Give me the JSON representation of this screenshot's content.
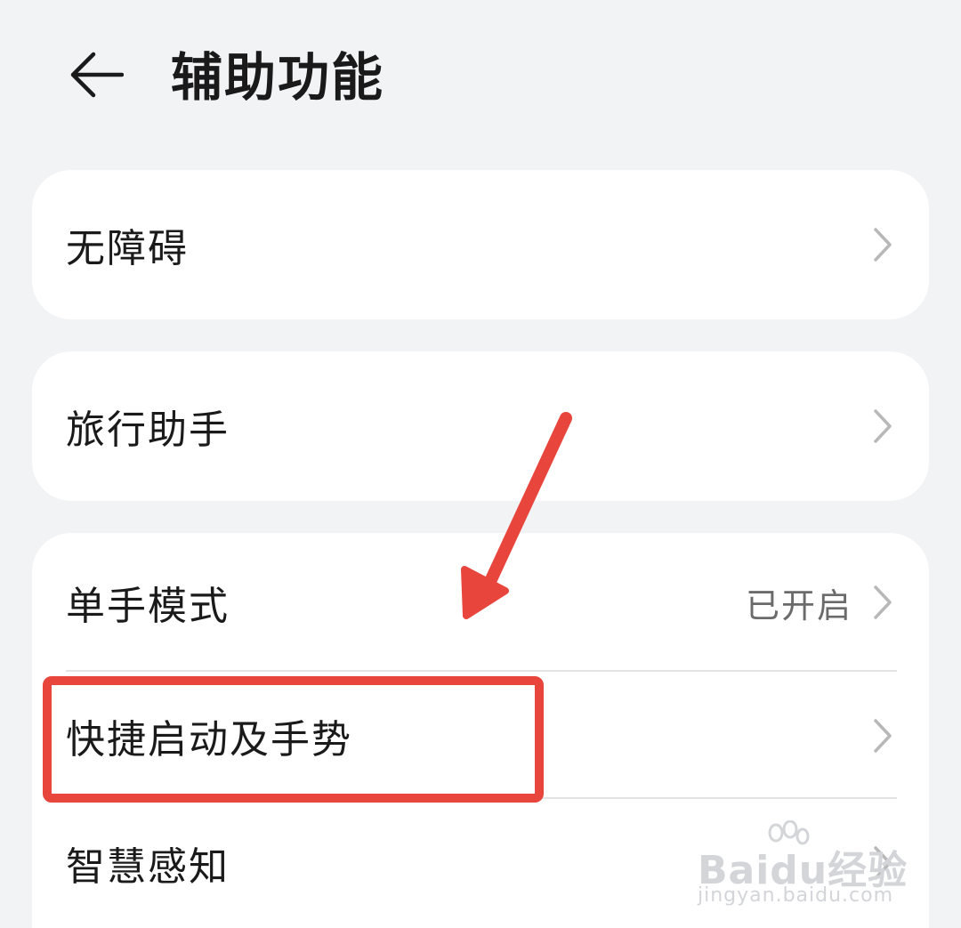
{
  "header": {
    "title": "辅助功能",
    "back_icon": "arrow-left-icon"
  },
  "cards": [
    {
      "rows": [
        {
          "label": "无障碍",
          "status": "",
          "icon": "chevron-right-icon"
        }
      ]
    },
    {
      "rows": [
        {
          "label": "旅行助手",
          "status": "",
          "icon": "chevron-right-icon"
        }
      ]
    },
    {
      "rows": [
        {
          "label": "单手模式",
          "status": "已开启",
          "icon": "chevron-right-icon"
        },
        {
          "label": "快捷启动及手势",
          "status": "",
          "icon": "chevron-right-icon"
        },
        {
          "label": "智慧感知",
          "status": "",
          "icon": "chevron-right-icon"
        }
      ]
    }
  ],
  "annotation": {
    "color": "#e8453c",
    "arrow_icon": "red-arrow-annotation",
    "box_target": "快捷启动及手势"
  },
  "watermark": {
    "brand": "Baidu经验",
    "site": "jingyan.baidu.com"
  },
  "colors": {
    "background": "#f1f3f5",
    "card": "#ffffff",
    "text": "#1a1a1a",
    "secondary_text": "#6b6b6b",
    "chevron": "#b8b8b8"
  }
}
